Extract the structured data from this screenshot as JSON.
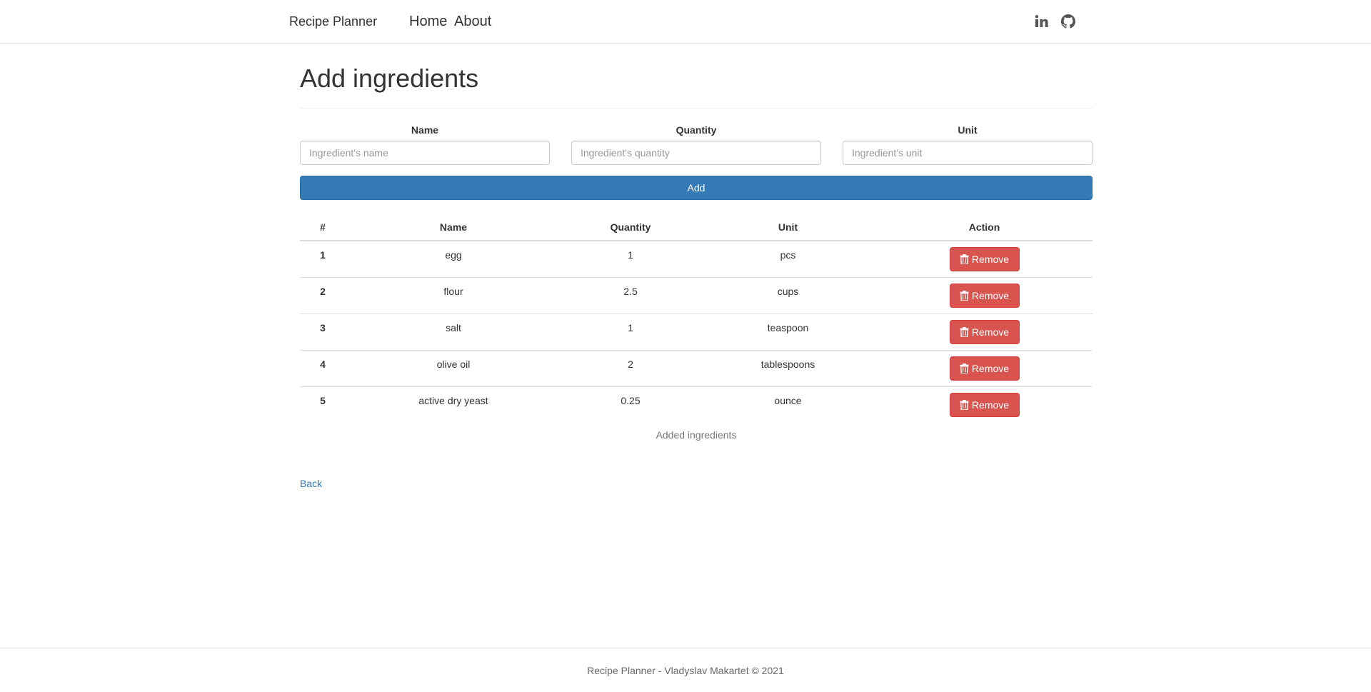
{
  "navbar": {
    "brand": "Recipe Planner",
    "links": [
      {
        "label": "Home"
      },
      {
        "label": "About"
      }
    ],
    "icons": [
      "linkedin-icon",
      "github-icon"
    ]
  },
  "page": {
    "title": "Add ingredients"
  },
  "form": {
    "name_label": "Name",
    "name_placeholder": "Ingredient's name",
    "name_value": "",
    "quantity_label": "Quantity",
    "quantity_placeholder": "Ingredient's quantity",
    "quantity_value": "",
    "unit_label": "Unit",
    "unit_placeholder": "Ingredient's unit",
    "unit_value": "",
    "add_label": "Add"
  },
  "table": {
    "headers": [
      "#",
      "Name",
      "Quantity",
      "Unit",
      "Action"
    ],
    "rows": [
      {
        "num": "1",
        "name": "egg",
        "quantity": "1",
        "unit": "pcs",
        "action": "Remove"
      },
      {
        "num": "2",
        "name": "flour",
        "quantity": "2.5",
        "unit": "cups",
        "action": "Remove"
      },
      {
        "num": "3",
        "name": "salt",
        "quantity": "1",
        "unit": "teaspoon",
        "action": "Remove"
      },
      {
        "num": "4",
        "name": "olive oil",
        "quantity": "2",
        "unit": "tablespoons",
        "action": "Remove"
      },
      {
        "num": "5",
        "name": "active dry yeast",
        "quantity": "0.25",
        "unit": "ounce",
        "action": "Remove"
      }
    ],
    "caption": "Added ingredients"
  },
  "back_link": "Back",
  "footer": {
    "text": "Recipe Planner - Vladyslav Makartet © 2021"
  },
  "colors": {
    "primary": "#337ab7",
    "danger": "#d9534f",
    "text": "#333333",
    "muted": "#777777"
  }
}
